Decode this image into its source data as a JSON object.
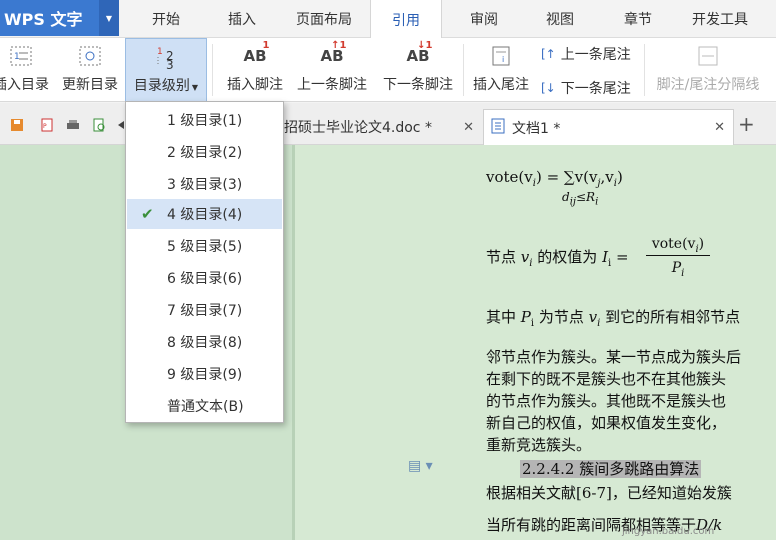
{
  "app": {
    "title": "WPS 文字"
  },
  "tabs": [
    "开始",
    "插入",
    "页面布局",
    "引用",
    "审阅",
    "视图",
    "章节",
    "开发工具"
  ],
  "active_tab": "引用",
  "ribbon": {
    "insert_toc": "插入目录",
    "update_toc": "更新目录",
    "toc_level": "目录级别",
    "insert_footnote": "插入脚注",
    "prev_footnote": "上一条脚注",
    "next_footnote": "下一条脚注",
    "insert_endnote": "插入尾注",
    "prev_endnote": "上一条尾注",
    "next_endnote": "下一条尾注",
    "note_separator": "脚注/尾注分隔线"
  },
  "doc_tabs": [
    {
      "name": "招硕士毕业论文4.doc *"
    },
    {
      "name": "文档1 *"
    }
  ],
  "toc_menu": {
    "items": [
      "1 级目录(1)",
      "2 级目录(2)",
      "3 级目录(3)",
      "4 级目录(4)",
      "5 级目录(5)",
      "6 级目录(6)",
      "7 级目录(7)",
      "8 级目录(8)",
      "9 级目录(9)",
      "普通文本(B)"
    ],
    "selected": "4 级目录(4)"
  },
  "document": {
    "formula1_lhs": "vote(v",
    "formula1_lhs_sub": "i",
    "formula1_rhs": ") = ∑v(v",
    "formula1_rhs2": ",v",
    "formula1_rhs3": ")",
    "formula1_under": "d",
    "formula1_under2": "≤R",
    "p1_a": "节点",
    "p1_b": "v",
    "p1_c": "的权值为",
    "p1_d": "I",
    "p1_e": " = ",
    "p1_num": "vote(v",
    "p1_den": "P",
    "p2_a": "其中",
    "p2_b": "P",
    "p2_c": "为节点",
    "p2_d": "v",
    "p2_e": "到它的所有相邻节点",
    "p3_l1": "邻节点作为簇头。某一节点成为簇头后",
    "p3_l2": "在剩下的既不是簇头也不在其他簇头",
    "p3_l3": "的节点作为簇头。其他既不是簇头也",
    "p3_l4": "新自己的权值，如果权值发生变化，",
    "p3_l5": "重新竞选簇头。",
    "heading": "2.2.4.2 簇间多跳路由算法",
    "p4": "根据相关文献[6-7]，已经知道始发簇",
    "p5_a": "当所有跳的距离间隔都相等等于",
    "p5_b": "D/k",
    "sub_i": "i",
    "sub_j": "j",
    "sub_ij": "ij"
  },
  "watermark": "jingyan.baidu.com",
  "colors": {
    "accent": "#3b79d0",
    "selection": "#cfe0f5",
    "doc_bg": "#d6e9d3",
    "check": "#3a8f3a"
  }
}
